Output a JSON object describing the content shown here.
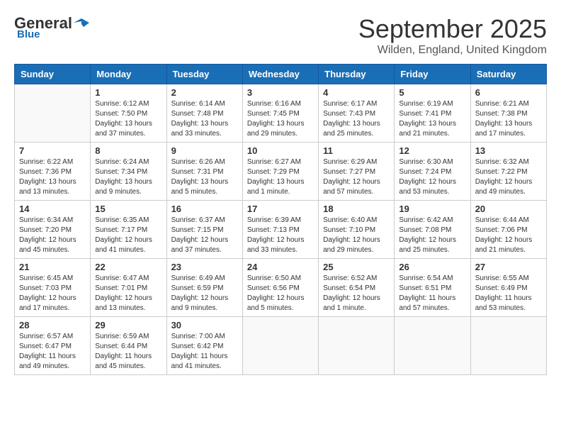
{
  "header": {
    "logo_line1": "General",
    "logo_line2": "Blue",
    "month_title": "September 2025",
    "location": "Wilden, England, United Kingdom"
  },
  "days_of_week": [
    "Sunday",
    "Monday",
    "Tuesday",
    "Wednesday",
    "Thursday",
    "Friday",
    "Saturday"
  ],
  "weeks": [
    [
      {
        "day": "",
        "detail": ""
      },
      {
        "day": "1",
        "detail": "Sunrise: 6:12 AM\nSunset: 7:50 PM\nDaylight: 13 hours\nand 37 minutes."
      },
      {
        "day": "2",
        "detail": "Sunrise: 6:14 AM\nSunset: 7:48 PM\nDaylight: 13 hours\nand 33 minutes."
      },
      {
        "day": "3",
        "detail": "Sunrise: 6:16 AM\nSunset: 7:45 PM\nDaylight: 13 hours\nand 29 minutes."
      },
      {
        "day": "4",
        "detail": "Sunrise: 6:17 AM\nSunset: 7:43 PM\nDaylight: 13 hours\nand 25 minutes."
      },
      {
        "day": "5",
        "detail": "Sunrise: 6:19 AM\nSunset: 7:41 PM\nDaylight: 13 hours\nand 21 minutes."
      },
      {
        "day": "6",
        "detail": "Sunrise: 6:21 AM\nSunset: 7:38 PM\nDaylight: 13 hours\nand 17 minutes."
      }
    ],
    [
      {
        "day": "7",
        "detail": "Sunrise: 6:22 AM\nSunset: 7:36 PM\nDaylight: 13 hours\nand 13 minutes."
      },
      {
        "day": "8",
        "detail": "Sunrise: 6:24 AM\nSunset: 7:34 PM\nDaylight: 13 hours\nand 9 minutes."
      },
      {
        "day": "9",
        "detail": "Sunrise: 6:26 AM\nSunset: 7:31 PM\nDaylight: 13 hours\nand 5 minutes."
      },
      {
        "day": "10",
        "detail": "Sunrise: 6:27 AM\nSunset: 7:29 PM\nDaylight: 13 hours\nand 1 minute."
      },
      {
        "day": "11",
        "detail": "Sunrise: 6:29 AM\nSunset: 7:27 PM\nDaylight: 12 hours\nand 57 minutes."
      },
      {
        "day": "12",
        "detail": "Sunrise: 6:30 AM\nSunset: 7:24 PM\nDaylight: 12 hours\nand 53 minutes."
      },
      {
        "day": "13",
        "detail": "Sunrise: 6:32 AM\nSunset: 7:22 PM\nDaylight: 12 hours\nand 49 minutes."
      }
    ],
    [
      {
        "day": "14",
        "detail": "Sunrise: 6:34 AM\nSunset: 7:20 PM\nDaylight: 12 hours\nand 45 minutes."
      },
      {
        "day": "15",
        "detail": "Sunrise: 6:35 AM\nSunset: 7:17 PM\nDaylight: 12 hours\nand 41 minutes."
      },
      {
        "day": "16",
        "detail": "Sunrise: 6:37 AM\nSunset: 7:15 PM\nDaylight: 12 hours\nand 37 minutes."
      },
      {
        "day": "17",
        "detail": "Sunrise: 6:39 AM\nSunset: 7:13 PM\nDaylight: 12 hours\nand 33 minutes."
      },
      {
        "day": "18",
        "detail": "Sunrise: 6:40 AM\nSunset: 7:10 PM\nDaylight: 12 hours\nand 29 minutes."
      },
      {
        "day": "19",
        "detail": "Sunrise: 6:42 AM\nSunset: 7:08 PM\nDaylight: 12 hours\nand 25 minutes."
      },
      {
        "day": "20",
        "detail": "Sunrise: 6:44 AM\nSunset: 7:06 PM\nDaylight: 12 hours\nand 21 minutes."
      }
    ],
    [
      {
        "day": "21",
        "detail": "Sunrise: 6:45 AM\nSunset: 7:03 PM\nDaylight: 12 hours\nand 17 minutes."
      },
      {
        "day": "22",
        "detail": "Sunrise: 6:47 AM\nSunset: 7:01 PM\nDaylight: 12 hours\nand 13 minutes."
      },
      {
        "day": "23",
        "detail": "Sunrise: 6:49 AM\nSunset: 6:59 PM\nDaylight: 12 hours\nand 9 minutes."
      },
      {
        "day": "24",
        "detail": "Sunrise: 6:50 AM\nSunset: 6:56 PM\nDaylight: 12 hours\nand 5 minutes."
      },
      {
        "day": "25",
        "detail": "Sunrise: 6:52 AM\nSunset: 6:54 PM\nDaylight: 12 hours\nand 1 minute."
      },
      {
        "day": "26",
        "detail": "Sunrise: 6:54 AM\nSunset: 6:51 PM\nDaylight: 11 hours\nand 57 minutes."
      },
      {
        "day": "27",
        "detail": "Sunrise: 6:55 AM\nSunset: 6:49 PM\nDaylight: 11 hours\nand 53 minutes."
      }
    ],
    [
      {
        "day": "28",
        "detail": "Sunrise: 6:57 AM\nSunset: 6:47 PM\nDaylight: 11 hours\nand 49 minutes."
      },
      {
        "day": "29",
        "detail": "Sunrise: 6:59 AM\nSunset: 6:44 PM\nDaylight: 11 hours\nand 45 minutes."
      },
      {
        "day": "30",
        "detail": "Sunrise: 7:00 AM\nSunset: 6:42 PM\nDaylight: 11 hours\nand 41 minutes."
      },
      {
        "day": "",
        "detail": ""
      },
      {
        "day": "",
        "detail": ""
      },
      {
        "day": "",
        "detail": ""
      },
      {
        "day": "",
        "detail": ""
      }
    ]
  ]
}
